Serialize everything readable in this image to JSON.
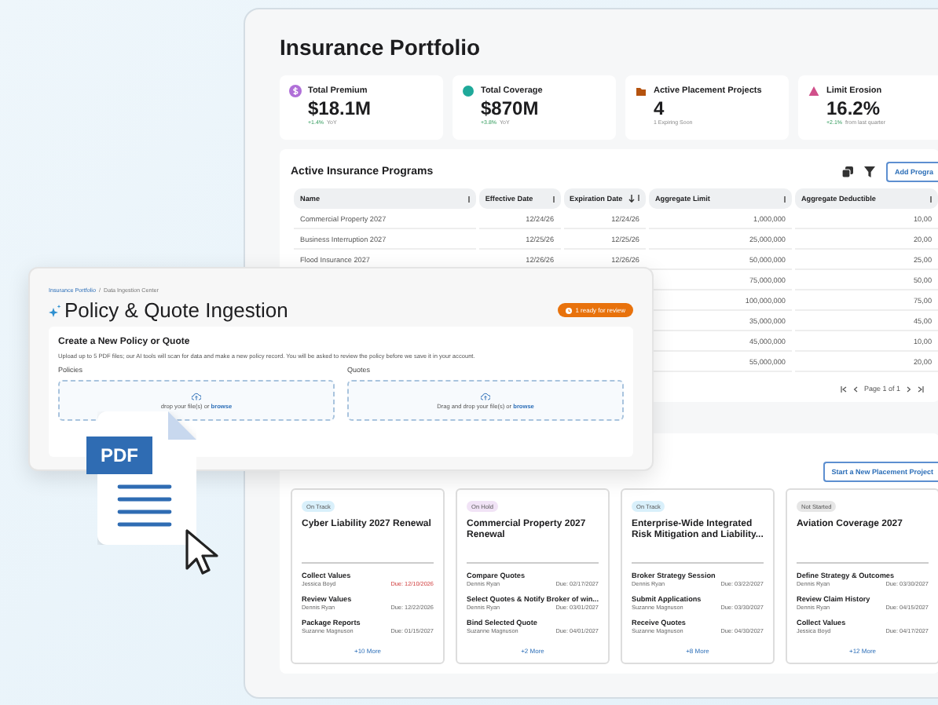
{
  "portfolio": {
    "title": "Insurance Portfolio",
    "kpis": [
      {
        "label": "Total Premium",
        "value": "$18.1M",
        "delta": "+1.4%",
        "note": "YoY",
        "color": "#b06fd8"
      },
      {
        "label": "Total Coverage",
        "value": "$870M",
        "delta": "+3.8%",
        "note": "YoY",
        "color": "#1fa99a"
      },
      {
        "label": "Active Placement Projects",
        "value": "4",
        "note": "1 Expiring Soon",
        "color": "#b5530f"
      },
      {
        "label": "Limit Erosion",
        "value": "16.2%",
        "delta": "+2.1%",
        "note": "from last quarter",
        "color": "#d0508a"
      }
    ],
    "programs": {
      "title": "Active Insurance Programs",
      "add_button": "Add Progra",
      "columns": [
        {
          "label": "Name",
          "sorted": false
        },
        {
          "label": "Effective Date",
          "sorted": false
        },
        {
          "label": "Expiration Date",
          "sorted": true
        },
        {
          "label": "Aggregate Limit",
          "sorted": false
        },
        {
          "label": "Aggregate Deductible",
          "sorted": false
        }
      ],
      "rows": [
        {
          "name": "Commercial Property 2027",
          "effective": "12/24/26",
          "expiration": "12/24/26",
          "limit": "1,000,000",
          "deductible": "10,00"
        },
        {
          "name": "Business Interruption 2027",
          "effective": "12/25/26",
          "expiration": "12/25/26",
          "limit": "25,000,000",
          "deductible": "20,00"
        },
        {
          "name": "Flood Insurance 2027",
          "effective": "12/26/26",
          "expiration": "12/26/26",
          "limit": "50,000,000",
          "deductible": "25,00"
        },
        {
          "limit": "75,000,000",
          "deductible": "50,00"
        },
        {
          "limit": "100,000,000",
          "deductible": "75,00"
        },
        {
          "limit": "35,000,000",
          "deductible": "45,00"
        },
        {
          "limit": "45,000,000",
          "deductible": "10,00"
        },
        {
          "limit": "55,000,000",
          "deductible": "20,00"
        }
      ],
      "pagination": "Page 1 of 1"
    },
    "projects": {
      "start_button": "Start a New Placement Project",
      "cards": [
        {
          "status": "On Track",
          "color": "#d9f0fb",
          "title": "Cyber Liability 2027 Renewal",
          "tasks": [
            {
              "name": "Collect Values",
              "owner": "Jessica Boyd",
              "due": "Due: 12/10/2026",
              "overdue": true
            },
            {
              "name": "Review Values",
              "owner": "Dennis Ryan",
              "due": "Due: 12/22/2026",
              "overdue": false
            },
            {
              "name": "Package Reports",
              "owner": "Suzanne Magnuson",
              "due": "Due: 01/15/2027",
              "overdue": false
            }
          ],
          "more": "+10 More"
        },
        {
          "status": "On Hold",
          "color": "#f1e3f6",
          "title": "Commercial Property 2027 Renewal",
          "tasks": [
            {
              "name": "Compare Quotes",
              "owner": "Dennis Ryan",
              "due": "Due: 02/17/2027",
              "overdue": false
            },
            {
              "name": "Select Quotes & Notify Broker of win...",
              "owner": "Dennis Ryan",
              "due": "Due: 03/01/2027",
              "overdue": false
            },
            {
              "name": "Bind Selected Quote",
              "owner": "Suzanne Magnuson",
              "due": "Due: 04/01/2027",
              "overdue": false
            }
          ],
          "more": "+2 More"
        },
        {
          "status": "On Track",
          "color": "#d9f0fb",
          "title": "Enterprise-Wide Integrated Risk Mitigation and Liability...",
          "tasks": [
            {
              "name": "Broker Strategy Session",
              "owner": "Dennis Ryan",
              "due": "Due: 03/22/2027",
              "overdue": false
            },
            {
              "name": "Submit Applications",
              "owner": "Suzanne Magnuson",
              "due": "Due: 03/30/2027",
              "overdue": false
            },
            {
              "name": "Receive Quotes",
              "owner": "Suzanne Magnuson",
              "due": "Due: 04/30/2027",
              "overdue": false
            }
          ],
          "more": "+8 More"
        },
        {
          "status": "Not Started",
          "color": "#e6e6e6",
          "title": "Aviation Coverage 2027",
          "tasks": [
            {
              "name": "Define Strategy & Outcomes",
              "owner": "Dennis Ryan",
              "due": "Due: 03/30/2027",
              "overdue": false
            },
            {
              "name": "Review Claim History",
              "owner": "Dennis Ryan",
              "due": "Due: 04/15/2027",
              "overdue": false
            },
            {
              "name": "Collect Values",
              "owner": "Jessica Boyd",
              "due": "Due: 04/17/2027",
              "overdue": false
            }
          ],
          "more": "+12 More"
        }
      ]
    }
  },
  "ingestion": {
    "breadcrumb": [
      {
        "label": "Insurance Portfolio",
        "link": true
      },
      {
        "label": "/",
        "link": false
      },
      {
        "label": "Data Ingestion Center",
        "link": false
      }
    ],
    "title": "Policy & Quote Ingestion",
    "badge": "1 ready for review",
    "section_title": "Create a New Policy or Quote",
    "description": "Upload up to 5 PDF files; our AI tools will scan for data and make a new policy record. You will be asked to review the policy before we save it in your account.",
    "dropzones": [
      {
        "label": "Policies",
        "text": "drop your file(s) or",
        "link": "browse"
      },
      {
        "label": "Quotes",
        "text": "Drag and drop your file(s) or",
        "link": "browse"
      }
    ]
  },
  "file_icon": {
    "label": "PDF"
  }
}
